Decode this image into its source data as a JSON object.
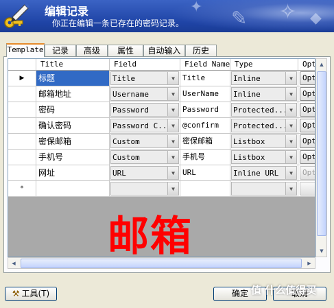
{
  "header": {
    "title": "编辑记录",
    "subtitle": "你正在编辑一条已存在的密码记录。"
  },
  "tabs": [
    {
      "label": "Template"
    },
    {
      "label": "记录"
    },
    {
      "label": "高级"
    },
    {
      "label": "属性"
    },
    {
      "label": "自动输入"
    },
    {
      "label": "历史"
    }
  ],
  "grid": {
    "columns": [
      "",
      "Title",
      "Field",
      "Field Name",
      "Type",
      "Opt"
    ],
    "rows": [
      {
        "marker": "▶",
        "title": "标题",
        "field": "Title",
        "field_name": "Title",
        "type": "Inline",
        "opt": "Opt",
        "selected": true
      },
      {
        "marker": "",
        "title": "邮箱地址",
        "field": "Username",
        "field_name": "UserName",
        "type": "Inline",
        "opt": "Opt"
      },
      {
        "marker": "",
        "title": "密码",
        "field": "Password",
        "field_name": "Password",
        "type": "Protected...",
        "opt": "Opt"
      },
      {
        "marker": "",
        "title": "确认密码",
        "field": "Password C...",
        "field_name": "@confirm",
        "type": "Protected...",
        "opt": "Opt"
      },
      {
        "marker": "",
        "title": "密保邮箱",
        "field": "Custom",
        "field_name": "密保邮箱",
        "type": "Listbox",
        "opt": "Opt"
      },
      {
        "marker": "",
        "title": "手机号",
        "field": "Custom",
        "field_name": "手机号",
        "type": "Listbox",
        "opt": "Opt"
      },
      {
        "marker": "",
        "title": "网址",
        "field": "URL",
        "field_name": "URL",
        "type": "Inline URL",
        "opt": "Opt",
        "opt_disabled": true
      }
    ],
    "new_row_marker": "*",
    "overlay_text": "邮箱"
  },
  "buttons": {
    "tools": "工具(T)",
    "ok": "确定",
    "cancel": "取消"
  },
  "watermark_brand": "值 什么值得买",
  "colors": {
    "header_blue": "#1f44a6",
    "selection": "#316ac5",
    "overlay_red": "#ff0000"
  }
}
